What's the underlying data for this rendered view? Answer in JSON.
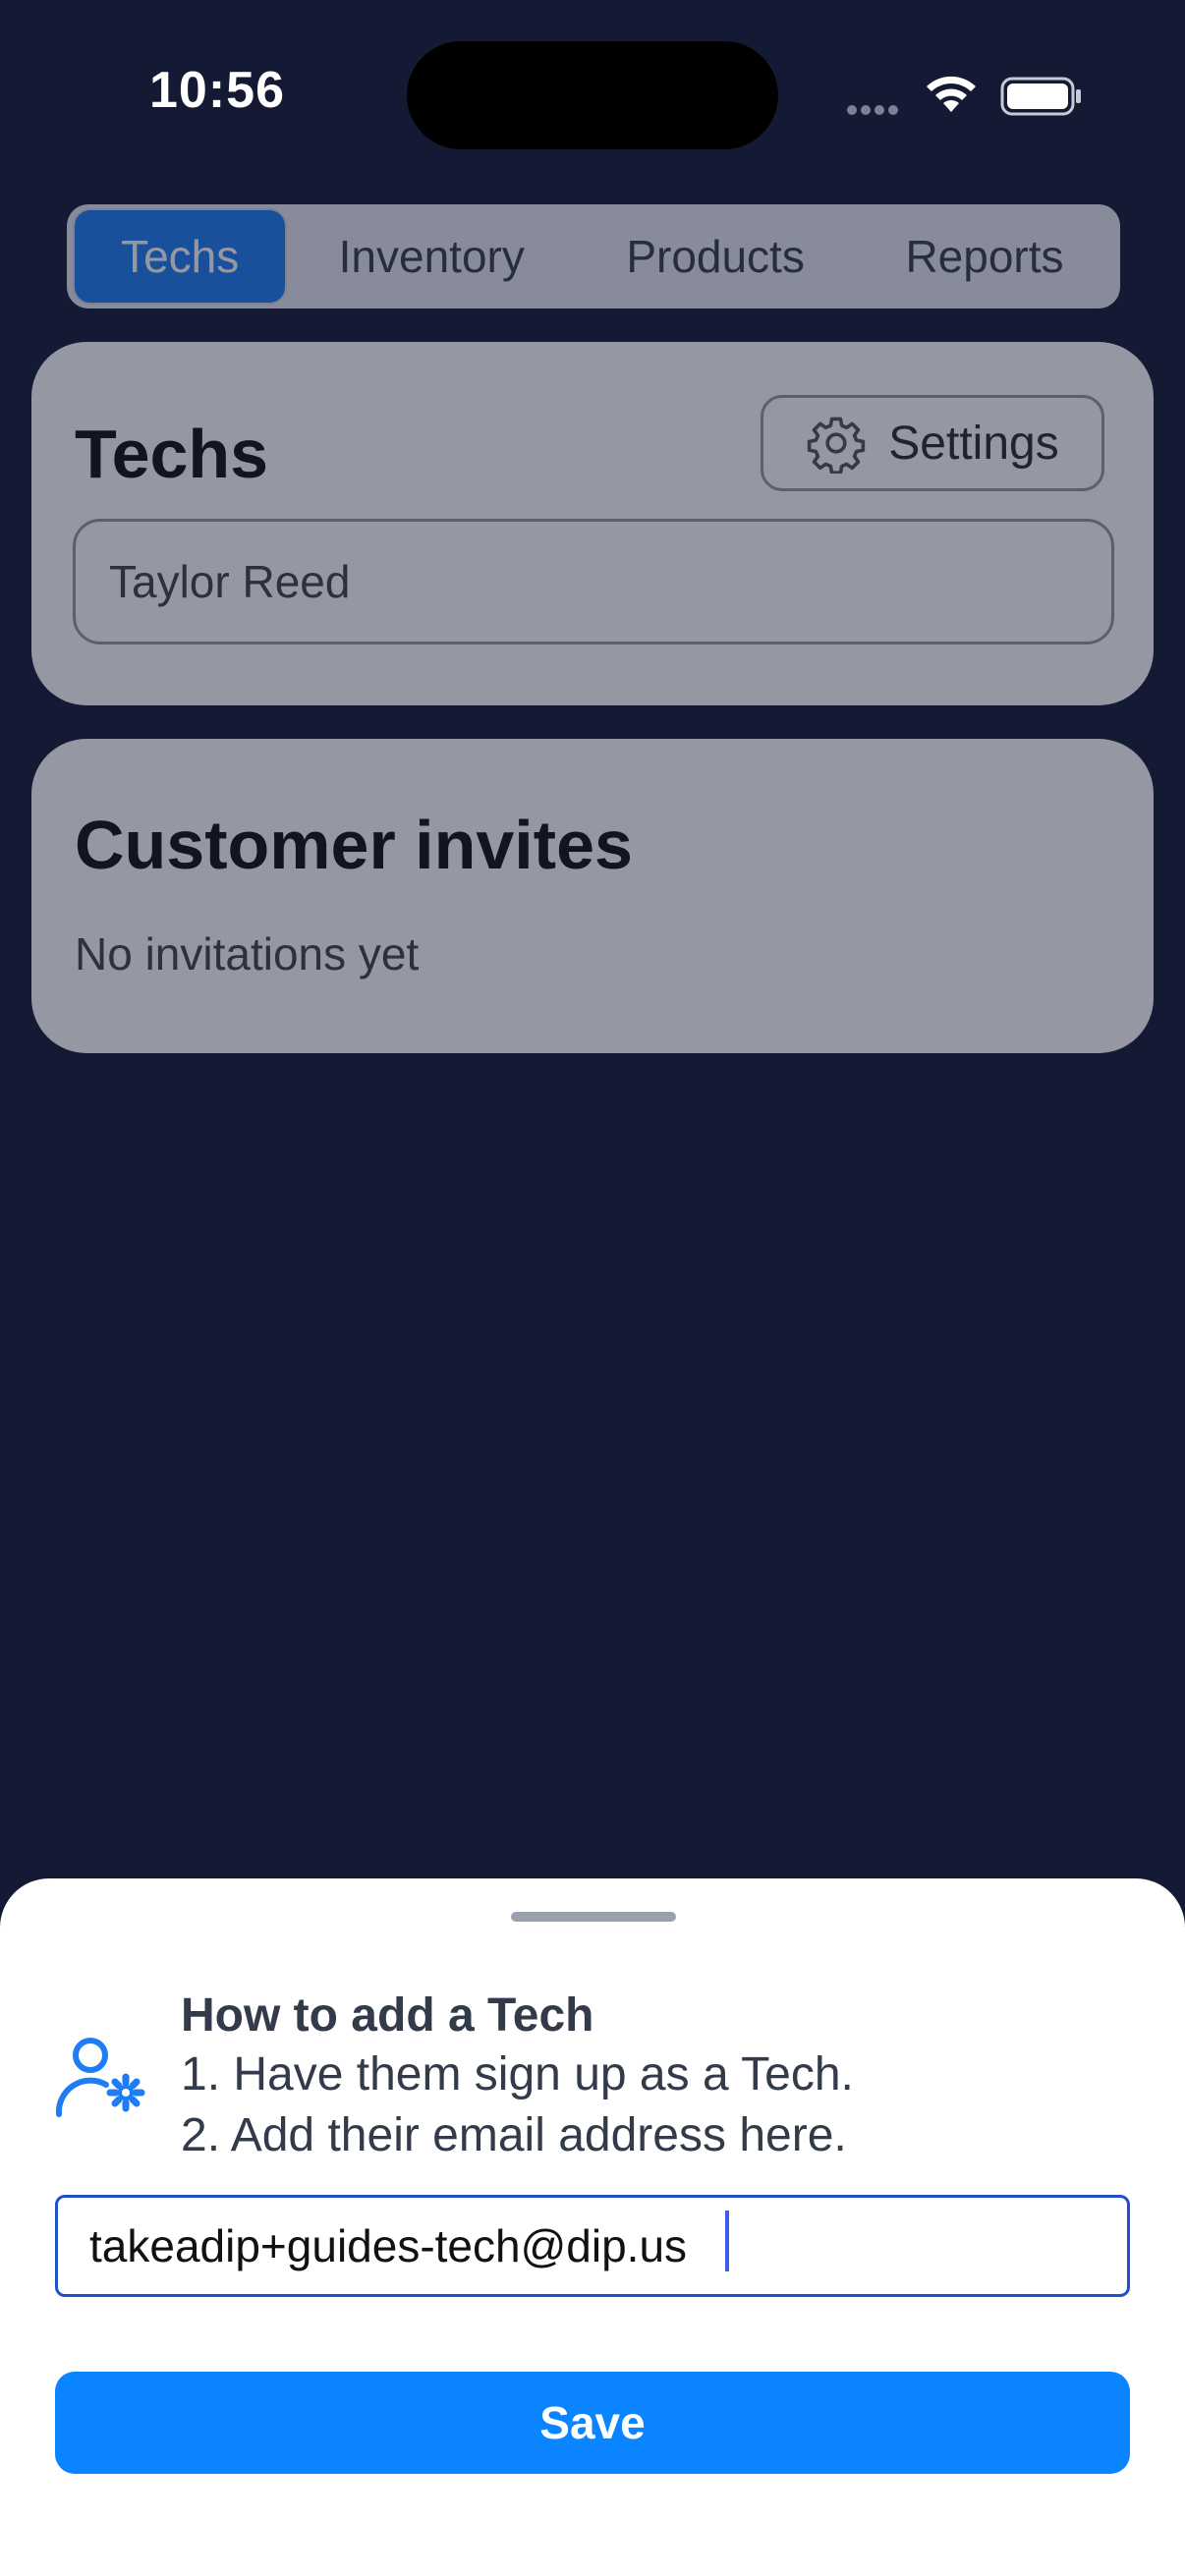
{
  "status": {
    "time": "10:56"
  },
  "tabs": [
    {
      "label": "Techs",
      "active": true
    },
    {
      "label": "Inventory",
      "active": false
    },
    {
      "label": "Products",
      "active": false
    },
    {
      "label": "Reports",
      "active": false
    }
  ],
  "techs_card": {
    "title": "Techs",
    "settings_label": "Settings",
    "settings_icon": "gear-icon",
    "tech_name": "Taylor Reed"
  },
  "invites_card": {
    "title": "Customer invites",
    "empty_text": "No invitations yet"
  },
  "sheet": {
    "help_icon": "user-gear-icon",
    "help_title": "How to add a Tech",
    "step_1": "1. Have them sign up as a Tech.",
    "step_2": "2. Add their email address here.",
    "email_value": "takeadip+guides-tech@dip.us",
    "save_label": "Save"
  },
  "colors": {
    "background": "#141a34",
    "accent": "#0a84ff",
    "active_tab": "#1e7df2",
    "input_border": "#1f4fc9"
  }
}
